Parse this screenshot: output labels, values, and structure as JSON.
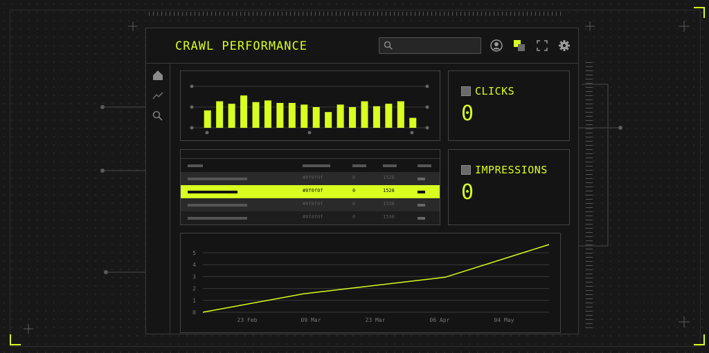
{
  "header": {
    "title": "CRAWL PERFORMANCE",
    "search_placeholder": ""
  },
  "kpis": [
    {
      "label": "CLICKS",
      "value": "0"
    },
    {
      "label": "IMPRESSIONS",
      "value": "0"
    }
  ],
  "table": {
    "rows": [
      {
        "color": "#0f0f0f",
        "value1": "0",
        "value2": "1528",
        "highlighted": false
      },
      {
        "color": "#0f0f0f",
        "value1": "0",
        "value2": "1528",
        "highlighted": true
      },
      {
        "color": "#0f0f0f",
        "value1": "0",
        "value2": "1538",
        "highlighted": false
      },
      {
        "color": "#0f0f0f",
        "value1": "0",
        "value2": "1538",
        "highlighted": false
      }
    ]
  },
  "colors": {
    "accent": "#d8ff1f",
    "background": "#181818",
    "panel": "#141414",
    "grid": "#3c3c3c"
  },
  "chart_data": [
    {
      "type": "bar",
      "title": "",
      "values": [
        0.42,
        0.64,
        0.58,
        0.78,
        0.62,
        0.66,
        0.6,
        0.6,
        0.56,
        0.5,
        0.38,
        0.56,
        0.5,
        0.64,
        0.52,
        0.58,
        0.64,
        0.24
      ]
    },
    {
      "type": "line",
      "title": "",
      "x_labels": [
        "23 Feb",
        "09 Mar",
        "23 Mar",
        "06 Apr",
        "04 May"
      ],
      "y_ticks": [
        "0",
        "1",
        "2",
        "3",
        "4",
        "5"
      ],
      "ylim": [
        0,
        5.7
      ],
      "x": [
        0,
        0.29,
        0.7,
        1.0
      ],
      "series": [
        {
          "values": [
            0,
            1.55,
            2.95,
            5.7
          ]
        }
      ]
    }
  ]
}
